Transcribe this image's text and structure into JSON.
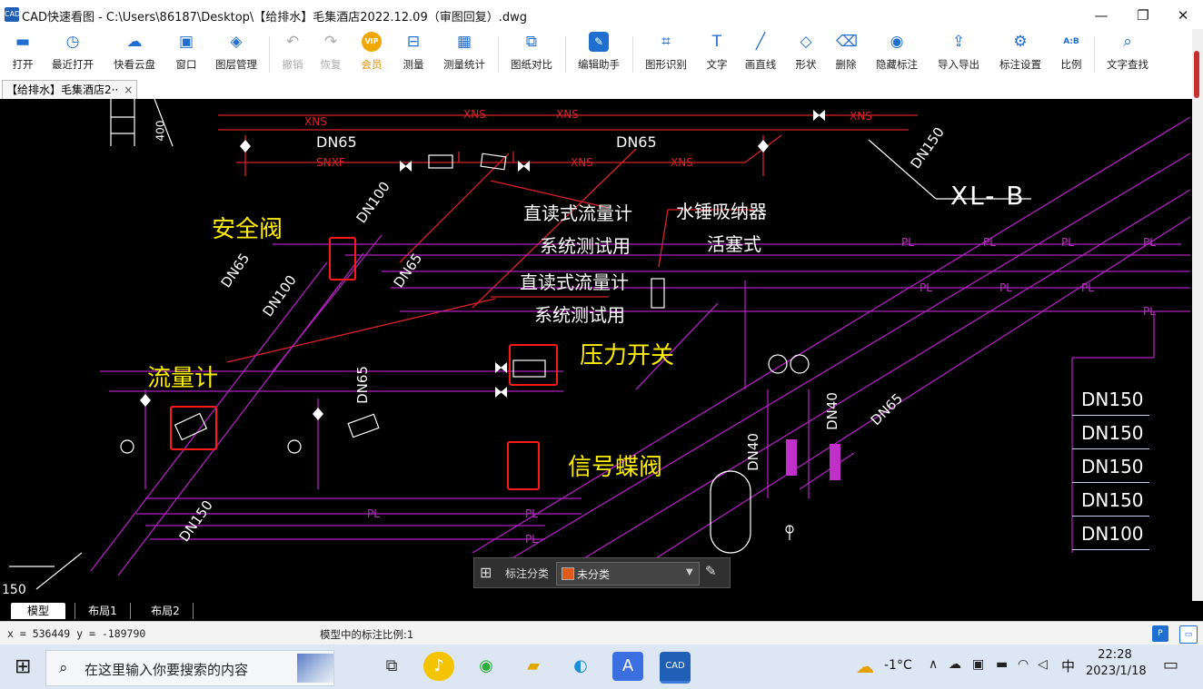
{
  "window": {
    "title": "CAD快速看图 - C:\\Users\\86187\\Desktop\\【给排水】毛集酒店2022.12.09（审图回复）.dwg",
    "app_icon_text": "CAD",
    "minimize": "—",
    "maximize": "❐",
    "close": "✕"
  },
  "toolbar": {
    "items": [
      {
        "label": "打开",
        "icon": "folder-icon"
      },
      {
        "label": "最近打开",
        "icon": "history-icon"
      },
      {
        "label": "快看云盘",
        "icon": "cloud-icon"
      },
      {
        "label": "窗口",
        "icon": "window-icon"
      },
      {
        "label": "图层管理",
        "icon": "layers-icon"
      },
      {
        "label": "撤销",
        "icon": "undo-icon"
      },
      {
        "label": "恢复",
        "icon": "redo-icon"
      },
      {
        "label": "会员",
        "icon": "vip-icon"
      },
      {
        "label": "测量",
        "icon": "ruler-icon"
      },
      {
        "label": "测量统计",
        "icon": "measure-stats-icon"
      },
      {
        "label": "图纸对比",
        "icon": "compare-icon"
      },
      {
        "label": "编辑助手",
        "icon": "edit-assistant-icon"
      },
      {
        "label": "图形识别",
        "icon": "shape-recognize-icon"
      },
      {
        "label": "文字",
        "icon": "text-icon"
      },
      {
        "label": "画直线",
        "icon": "line-icon"
      },
      {
        "label": "形状",
        "icon": "shape-icon"
      },
      {
        "label": "删除",
        "icon": "eraser-icon"
      },
      {
        "label": "隐藏标注",
        "icon": "hide-icon"
      },
      {
        "label": "导入导出",
        "icon": "import-export-icon"
      },
      {
        "label": "标注设置",
        "icon": "annotation-settings-icon"
      },
      {
        "label": "比例",
        "icon": "scale-icon"
      },
      {
        "label": "文字查找",
        "icon": "text-search-icon"
      }
    ],
    "vip_text": "VIP",
    "scale_icon_text": "A:B"
  },
  "doc_tab": {
    "label": "【给排水】毛集酒店2··",
    "close": "×"
  },
  "annotations": {
    "safety_valve": "安全阀",
    "flow_meter": "流量计",
    "pressure_switch": "压力开关",
    "signal_butterfly_valve": "信号蝶阀"
  },
  "drawing_text": {
    "direct_flowmeter": "直读式流量计",
    "system_test": "系统测试用",
    "water_hammer": "水锤吸纳器",
    "piston_type": "活塞式",
    "riser": "XL- B",
    "dn65": "DN65",
    "dn100": "DN100",
    "dn150": "DN150",
    "dn40": "DN40",
    "xns": "XNS",
    "snxf": "SNXF",
    "pl": "PL",
    "dim_400": "400",
    "corner_150": "150",
    "dn_list": [
      "DN150",
      "DN150",
      "DN150",
      "DN150",
      "DN100"
    ]
  },
  "layer_panel": {
    "label": "标注分类",
    "value": "未分类",
    "swatch_color": "#e25a1c"
  },
  "layout_tabs": [
    "模型",
    "布局1",
    "布局2"
  ],
  "status": {
    "coords": "x = 536449  y = -189790",
    "scale": "模型中的标注比例:1"
  },
  "taskbar": {
    "search_placeholder": "在这里输入你要搜索的内容",
    "weather": "-1°C",
    "ime": "中",
    "time": "22:28",
    "date": "2023/1/18"
  },
  "colors": {
    "pipe_red": "#d8232a",
    "pipe_magenta": "#b020c0",
    "annotation_yellow": "#ffee00",
    "highlight_red": "#ff1a1a"
  }
}
